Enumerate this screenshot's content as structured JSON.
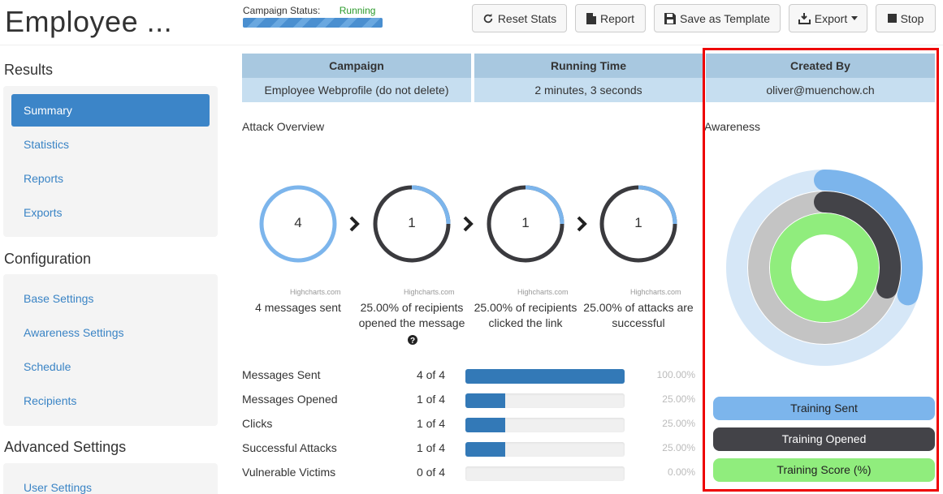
{
  "page": {
    "title": "Employee ..."
  },
  "sidebar": {
    "sections": [
      {
        "header": "Results",
        "items": [
          {
            "label": "Summary",
            "active": true
          },
          {
            "label": "Statistics"
          },
          {
            "label": "Reports"
          },
          {
            "label": "Exports"
          }
        ]
      },
      {
        "header": "Configuration",
        "items": [
          {
            "label": "Base Settings"
          },
          {
            "label": "Awareness Settings"
          },
          {
            "label": "Schedule"
          },
          {
            "label": "Recipients"
          }
        ]
      },
      {
        "header": "Advanced Settings",
        "items": [
          {
            "label": "User Settings"
          }
        ]
      }
    ]
  },
  "status": {
    "label": "Campaign Status:",
    "value": "Running"
  },
  "toolbar": {
    "reset": "Reset Stats",
    "report": "Report",
    "save_template": "Save as Template",
    "export": "Export",
    "stop": "Stop"
  },
  "info": {
    "campaign_header": "Campaign",
    "campaign_value": "Employee Webprofile (do not delete)",
    "running_header": "Running Time",
    "running_value": "2 minutes, 3 seconds",
    "created_header": "Created By",
    "created_value": "oliver@muenchow.ch"
  },
  "attack_overview": {
    "title": "Attack Overview",
    "credit": "Highcharts.com",
    "donuts": [
      {
        "value": "4",
        "fraction": 1.0,
        "color": "#7cb5ec",
        "caption1": "4 messages sent",
        "caption2": ""
      },
      {
        "value": "1",
        "fraction": 0.25,
        "color": "#7cb5ec",
        "caption1": "25.00% of recipients",
        "caption2": "opened the message"
      },
      {
        "value": "1",
        "fraction": 0.25,
        "color": "#7cb5ec",
        "caption1": "25.00% of recipients",
        "caption2": "clicked the link"
      },
      {
        "value": "1",
        "fraction": 0.25,
        "color": "#7cb5ec",
        "caption1": "25.00% of attacks are",
        "caption2": "successful"
      }
    ]
  },
  "stats": [
    {
      "label": "Messages Sent",
      "count": "4 of 4",
      "pct": "100.00%",
      "fraction": 1.0
    },
    {
      "label": "Messages Opened",
      "count": "1 of 4",
      "pct": "25.00%",
      "fraction": 0.25
    },
    {
      "label": "Clicks",
      "count": "1 of 4",
      "pct": "25.00%",
      "fraction": 0.25
    },
    {
      "label": "Successful Attacks",
      "count": "1 of 4",
      "pct": "25.00%",
      "fraction": 0.25
    },
    {
      "label": "Vulnerable Victims",
      "count": "0 of 4",
      "pct": "0.00%",
      "fraction": 0.0
    }
  ],
  "awareness": {
    "title": "Awareness",
    "rings": [
      {
        "name": "Training Sent",
        "fraction": 0.3,
        "color": "#7cb5ec"
      },
      {
        "name": "Training Opened",
        "fraction": 0.3,
        "color": "#434348"
      },
      {
        "name": "Training Score (%)",
        "fraction": 1.0,
        "color": "#90ed7d"
      }
    ],
    "legend": {
      "sent": "Training Sent",
      "opened": "Training Opened",
      "score": "Training Score (%)"
    }
  },
  "colors": {
    "accent": "#3c85c8",
    "link": "#3a84c5",
    "highlight": "#ee0000",
    "bar": "#3379b7"
  }
}
